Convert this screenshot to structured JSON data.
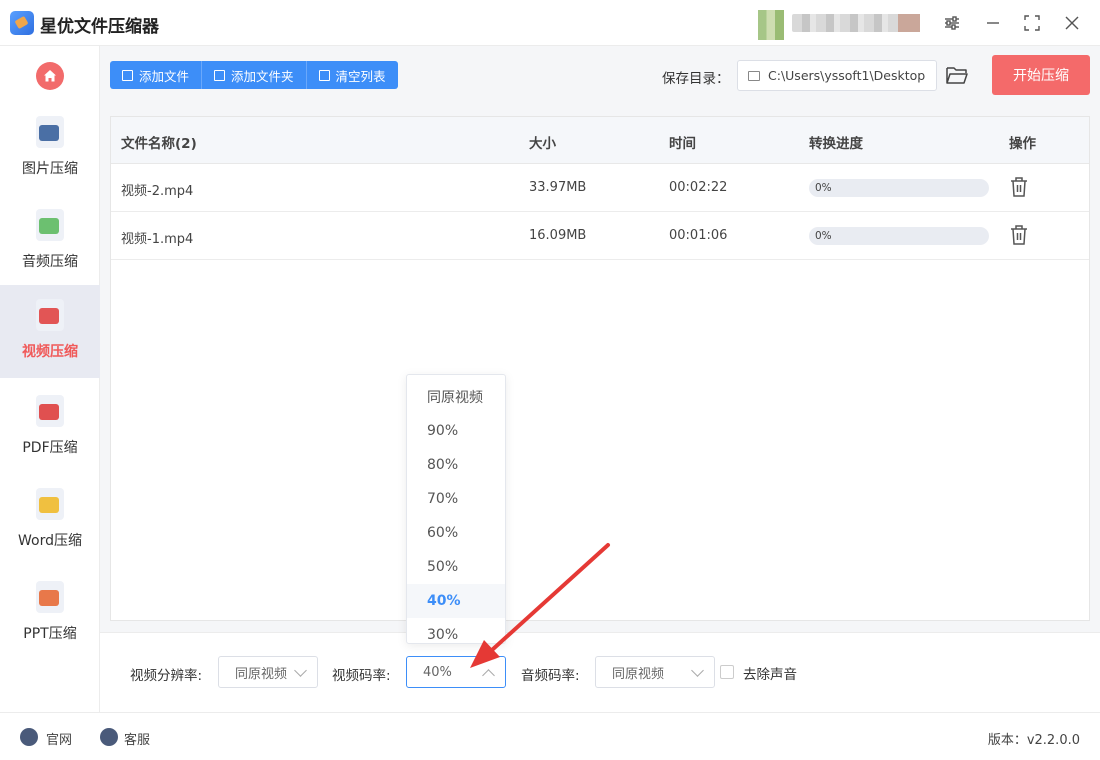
{
  "app": {
    "title": "星优文件压缩器"
  },
  "window": {
    "settings_icon": "sliders-icon",
    "minimize_icon": "minimize-icon",
    "maximize_icon": "maximize-icon",
    "close_icon": "close-icon"
  },
  "sidebar": {
    "home_icon": "home-icon",
    "items": [
      {
        "label": "图片压缩",
        "icon": "image-icon",
        "active": false
      },
      {
        "label": "音频压缩",
        "icon": "music-icon",
        "active": false
      },
      {
        "label": "视频压缩",
        "icon": "video-icon",
        "active": true
      },
      {
        "label": "PDF压缩",
        "icon": "pdf-icon",
        "active": false
      },
      {
        "label": "Word压缩",
        "icon": "word-icon",
        "active": false
      },
      {
        "label": "PPT压缩",
        "icon": "ppt-icon",
        "active": false
      }
    ]
  },
  "toolbar": {
    "add_file": "添加文件",
    "add_folder": "添加文件夹",
    "clear_list": "清空列表",
    "save_label": "保存目录：",
    "save_path": "C:\\Users\\yssoft1\\Desktop",
    "start": "开始压缩"
  },
  "table": {
    "headers": {
      "name": "文件名称(2)",
      "size": "大小",
      "time": "时间",
      "progress": "转换进度",
      "action": "操作"
    },
    "rows": [
      {
        "name": "视频-2.mp4",
        "size": "33.97MB",
        "time": "00:02:22",
        "progress": "0%",
        "progress_value": 0
      },
      {
        "name": "视频-1.mp4",
        "size": "16.09MB",
        "time": "00:01:06",
        "progress": "0%",
        "progress_value": 0
      }
    ]
  },
  "settings": {
    "resolution_label": "视频分辨率:",
    "resolution_value": "同原视频",
    "bitrate_label": "视频码率:",
    "bitrate_value": "40%",
    "audio_label": "音频码率:",
    "audio_value": "同原视频",
    "mute_label": "去除声音",
    "mute_checked": false
  },
  "dropdown": {
    "options": [
      "同原视频",
      "90%",
      "80%",
      "70%",
      "60%",
      "50%",
      "40%",
      "30%"
    ],
    "selected": "40%"
  },
  "statusbar": {
    "website": "官网",
    "support": "客服",
    "version": "版本：v2.2.0.0"
  },
  "colors": {
    "accent": "#3d8ef8",
    "start": "#f46a6a",
    "active_nav": "#f05a5a",
    "arrow": "#e53935"
  }
}
